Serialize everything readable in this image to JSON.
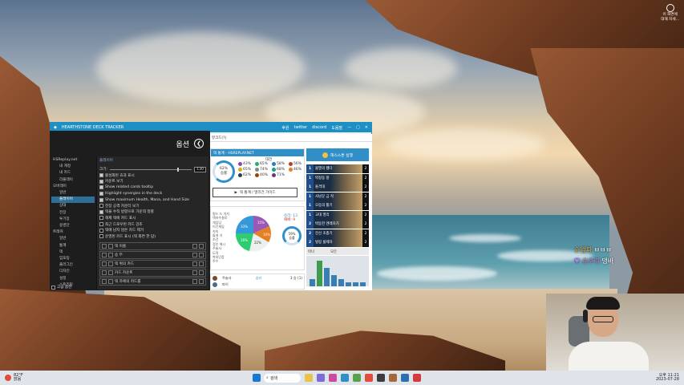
{
  "desktop": {
    "topright_text": "이 화면에\n대해 자세..."
  },
  "app": {
    "title": "HEARTHSTONE DECK TRACKER",
    "title_actions": [
      "후원",
      "twitter",
      "discord",
      "도움말"
    ],
    "options": {
      "header": "옵션",
      "tree": [
        {
          "label": "HSReplay.net",
          "level": 1
        },
        {
          "label": "내 계정",
          "level": 2
        },
        {
          "label": "내 카드",
          "level": 2
        },
        {
          "label": "리플레이",
          "level": 2
        },
        {
          "label": "오버레이",
          "level": 1
        },
        {
          "label": "일반",
          "level": 2
        },
        {
          "label": "플레이어",
          "level": 2,
          "selected": true
        },
        {
          "label": "상대",
          "level": 2
        },
        {
          "label": "전장",
          "level": 2
        },
        {
          "label": "투기장",
          "level": 2
        },
        {
          "label": "용병단",
          "level": 2
        },
        {
          "label": "트래커",
          "level": 1
        },
        {
          "label": "일반",
          "level": 2
        },
        {
          "label": "통계",
          "level": 2
        },
        {
          "label": "덱",
          "level": 2
        },
        {
          "label": "임포팅",
          "level": 2
        },
        {
          "label": "플러그인",
          "level": 2
        },
        {
          "label": "디자인",
          "level": 2
        },
        {
          "label": "설정",
          "level": 2
        },
        {
          "label": "스트리밍",
          "level": 2
        }
      ],
      "advanced_label": "고급 옵션",
      "pane": {
        "title": "플레이어",
        "size_label": "크기:",
        "size_value": "130",
        "checks": [
          "활성화된 효과 표시",
          "카운트 보기",
          "Show related cards tooltip",
          "Highlight synergies in the deck",
          "Show maximum Health, Mana, and Hand Size",
          "전장 공격 카운터 보기",
          "덱을 수직 방향으로 가운데 정렬",
          "해제 덱에 카드 표시",
          "최근 드로우된 카드 강조",
          "덱에 남지 않은 카드 제거",
          "운영된 카드 표시 (덱 화면 한 답)"
        ],
        "slots": [
          "덱 이름",
          "승 무",
          "덱 위의 카드",
          "카드 카운트",
          "덱 하에의 카드를"
        ]
      }
    },
    "web": {
      "address": "뷰크드(?)",
      "left_header": "덱 통계 - HSREPLAY.NET",
      "versus_label": "대전",
      "winrate_big": "62%",
      "winrate_big_sub": "승률",
      "class_pcts": [
        "43%",
        "65%",
        "58%",
        "56%",
        "65%",
        "74%",
        "68%",
        "46%",
        "62%",
        "40%",
        "71%"
      ],
      "analyze_button": "덱 통계 / 멀리건 가이드",
      "stats_list": [
        "필드 드 기지",
        "덱하수결로",
        "게임당",
        "이긴게임",
        "지속",
        "돌개 기",
        "조건",
        "정인 에시",
        "주술사",
        "도적",
        "복의단장",
        "주수"
      ],
      "wins_label": "승리: 13",
      "losses_label": "패배: 9",
      "winrate_small": "59%",
      "winrate_small_sub": "승률",
      "pie_labels": [
        "15%",
        "10%",
        "22%",
        "16%",
        "33%"
      ],
      "bottom_names": [
        "주술사",
        "파이"
      ],
      "bottom_vals": [
        "승리",
        "3 승 (1)"
      ],
      "right_title": "해스스톤 실행",
      "deck": [
        {
          "cost": "1",
          "name": "불멸의 웹다",
          "count": "2"
        },
        {
          "cost": "1",
          "name": "박정동 팡",
          "count": "2"
        },
        {
          "cost": "1",
          "name": "돌격대",
          "count": "2"
        },
        {
          "cost": "1",
          "name": "사냥꾼 금 작",
          "count": "2"
        },
        {
          "cost": "1",
          "name": "오동의 활기",
          "count": "2"
        },
        {
          "cost": "1",
          "name": "교대 영리",
          "count": "2"
        },
        {
          "cost": "2",
          "name": "박동한 엔레자기",
          "count": "2"
        },
        {
          "cost": "2",
          "name": "전선 조총기",
          "count": "2"
        },
        {
          "cost": "2",
          "name": "빌링 풀제자",
          "count": "2"
        }
      ],
      "curve_filter": [
        "마나",
        "모든"
      ],
      "mana_curve": [
        2,
        7,
        5,
        3,
        2,
        1,
        1,
        1
      ]
    }
  },
  "chat": [
    {
      "name": "순업파",
      "msg": "ㅂㅂㅂ"
    },
    {
      "name": "슈수리",
      "msg": "댕바"
    }
  ],
  "taskbar": {
    "weather_temp": "82°F",
    "weather_desc": "맑음",
    "search_placeholder": "검색",
    "time": "오후 11:21",
    "date": "2023-07-28"
  }
}
